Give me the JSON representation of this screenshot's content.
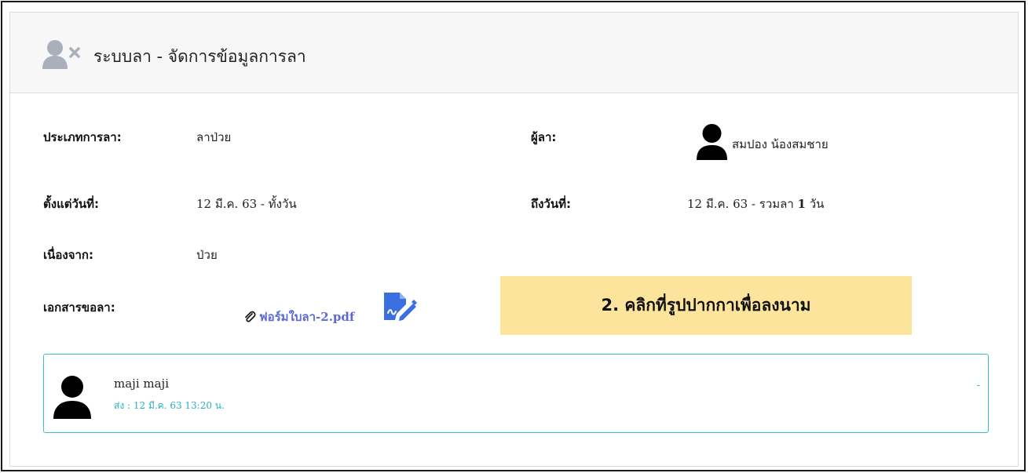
{
  "header": {
    "title": "ระบบลา - จัดการข้อมูลการลา",
    "icon": "user-remove-icon"
  },
  "fields": {
    "leave_type": {
      "label": "ประเภทการลา:",
      "value": "ลาป่วย"
    },
    "requester": {
      "label": "ผู้ลา:",
      "value": "สมปอง น้องสมชาย",
      "icon": "user-avatar-icon"
    },
    "from_date": {
      "label": "ตั้งแต่วันที่:",
      "value": "12 มี.ค. 63 - ทั้งวัน"
    },
    "to_date": {
      "label": "ถึงวันที่:",
      "value_prefix": "12 มี.ค. 63 - รวมลา ",
      "days": "1",
      "value_suffix": " วัน"
    },
    "reason": {
      "label": "เนื่องจาก:",
      "value": "ป่วย"
    },
    "documents": {
      "label": "เอกสารขอลา:",
      "file_name": "ฟอร์มใบลา-2.pdf",
      "file_icon": "paperclip-icon",
      "sign_icon": "signature-pen-icon"
    }
  },
  "callout": {
    "text": "2. คลิกที่รูปปากกาเพื่อลงนาม",
    "bg": "#fde49d"
  },
  "comment": {
    "name": "maji maji",
    "time": "ส่ง : 12 มี.ค. 63 13:20 น.",
    "extra": "-",
    "icon": "user-avatar-icon"
  },
  "colors": {
    "link": "#5b6ad6",
    "accent": "#39c0c8",
    "sign_icon": "#3b6fe0",
    "header_icon": "#aab0bb"
  }
}
